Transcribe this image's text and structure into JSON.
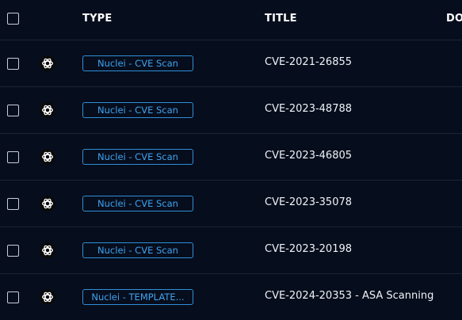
{
  "header": {
    "type_label": "TYPE",
    "title_label": "TITLE",
    "domain_label": "DO"
  },
  "rows": [
    {
      "type": "Nuclei - CVE Scan",
      "title": "CVE-2021-26855",
      "icon": "openai-logo-icon"
    },
    {
      "type": "Nuclei - CVE Scan",
      "title": "CVE-2023-48788",
      "icon": "openai-logo-icon"
    },
    {
      "type": "Nuclei - CVE Scan",
      "title": "CVE-2023-46805",
      "icon": "openai-logo-icon"
    },
    {
      "type": "Nuclei - CVE Scan",
      "title": "CVE-2023-35078",
      "icon": "openai-logo-icon"
    },
    {
      "type": "Nuclei - CVE Scan",
      "title": "CVE-2023-20198",
      "icon": "openai-logo-icon"
    },
    {
      "type": "Nuclei - TEMPLATE...",
      "title": "CVE-2024-20353 - ASA Scanning",
      "icon": "openai-logo-icon"
    }
  ],
  "colors": {
    "background": "#060d1c",
    "badge_border": "#2f8fd8",
    "badge_text": "#3ea3f0",
    "divider": "#1c2434"
  }
}
